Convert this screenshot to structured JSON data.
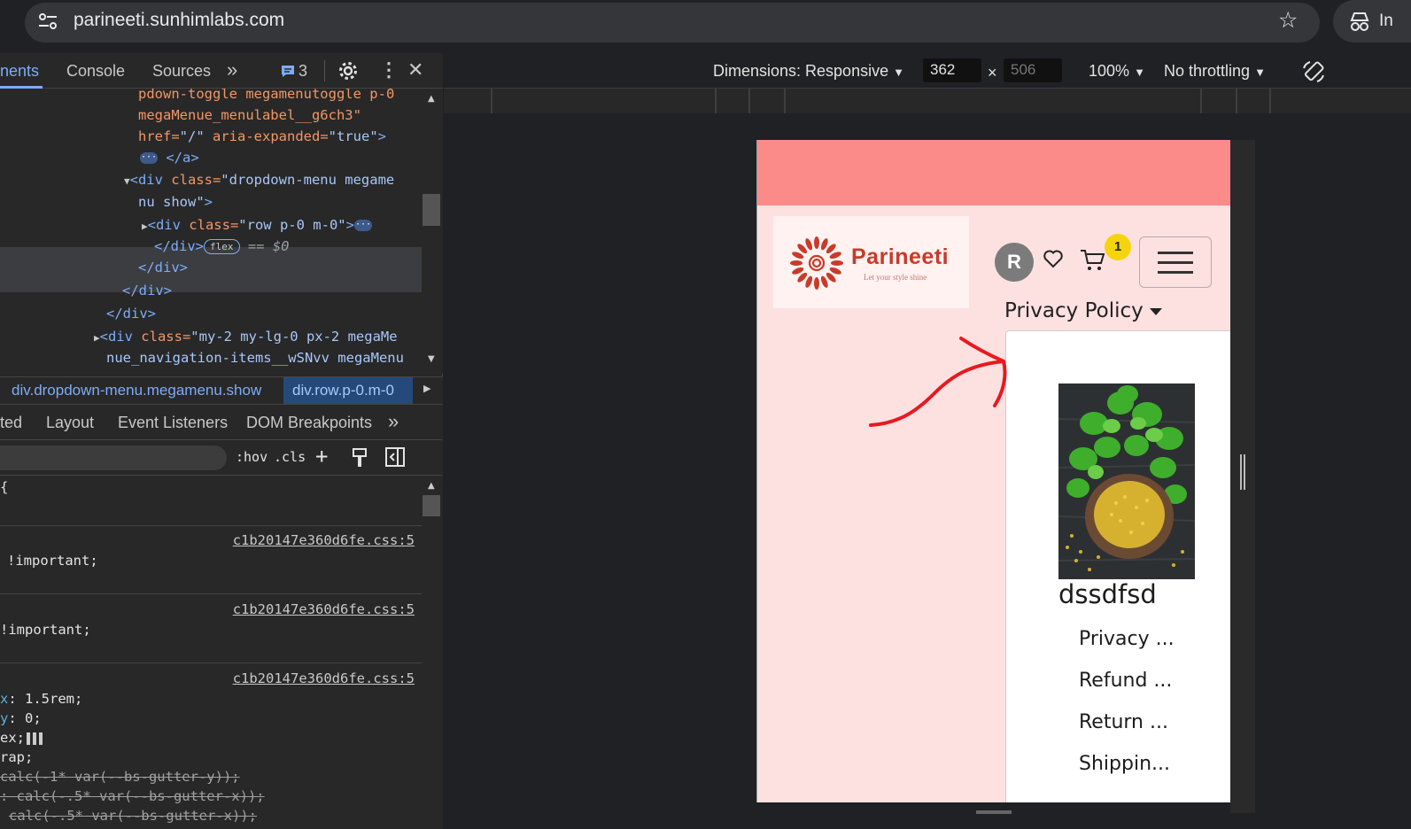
{
  "browser": {
    "url": "parineeti.sunhimlabs.com",
    "profile_label": "In"
  },
  "devtools": {
    "tabs": [
      "nents",
      "Console",
      "Sources"
    ],
    "issues_count": "3",
    "code_lines": {
      "l1": "pdown-toggle megamenutoggle p-0",
      "l2": "megaMenue_menulabel__g6ch3\"",
      "l3a": "href=",
      "l3b": "\"/\"",
      "l3c": " aria-expanded=",
      "l3d": "\"true\"",
      "l3e": ">",
      "l4": "</a>",
      "l5a": "<div ",
      "l5b": "class=",
      "l5c": "\"dropdown-menu megame",
      "l6": "nu show\"",
      "l6b": ">",
      "l7a": "<div ",
      "l7b": "class=",
      "l7c": "\"row p-0 m-0\"",
      "l7d": ">",
      "l8a": "</div>",
      "l8b": "flex",
      "l8c": "== $0",
      "l9": "</div>",
      "l10": "</div>",
      "l11": "</div>",
      "l12a": "<div ",
      "l12b": "class=",
      "l12c": "\"my-2 my-lg-0 px-2 megaMe",
      "l13": "nue_navigation-items__wSNvv megaMenu"
    },
    "breadcrumbs": [
      "div.dropdown-menu.megamenu.show",
      "div.row.p-0.m-0"
    ],
    "sub_tabs": [
      "ted",
      "Layout",
      "Event Listeners",
      "DOM Breakpoints"
    ],
    "filter_buttons": [
      ":hov",
      ".cls"
    ],
    "styles": {
      "source": "c1b20147e360d6fe.css:5",
      "r1": "!important;",
      "r2": "!important;",
      "p1a": "x",
      "p1b": ": 1.5rem;",
      "p2a": "y",
      "p2b": ": 0;",
      "p3": "ex;",
      "p4": "rap;",
      "p5": "calc(-1* var(--bs-gutter-y));",
      "p6": ": calc(-.5* var(--bs-gutter-x));",
      "p7": "calc(-.5* var(--bs-gutter-x));"
    }
  },
  "device_toolbar": {
    "dimensions": "Dimensions: Responsive",
    "width": "362",
    "times": "×",
    "height": "506",
    "zoom": "100%",
    "throttling": "No throttling"
  },
  "site": {
    "logo_name": "Parineeti",
    "logo_tagline": "Let your style shine",
    "avatar_initial": "R",
    "cart_count": "1",
    "menu_label": "Privacy Policy",
    "product_name": "dssdfsd",
    "menu_links": [
      "Privacy ...",
      "Refund ...",
      "Return ...",
      "Shippin..."
    ]
  },
  "colors": {
    "banner": "#fa8b88",
    "page_bg": "#fde1e0",
    "logo_red": "#c83a2a",
    "badge_yellow": "#f5d40f",
    "annotation_red": "#e8191f"
  }
}
